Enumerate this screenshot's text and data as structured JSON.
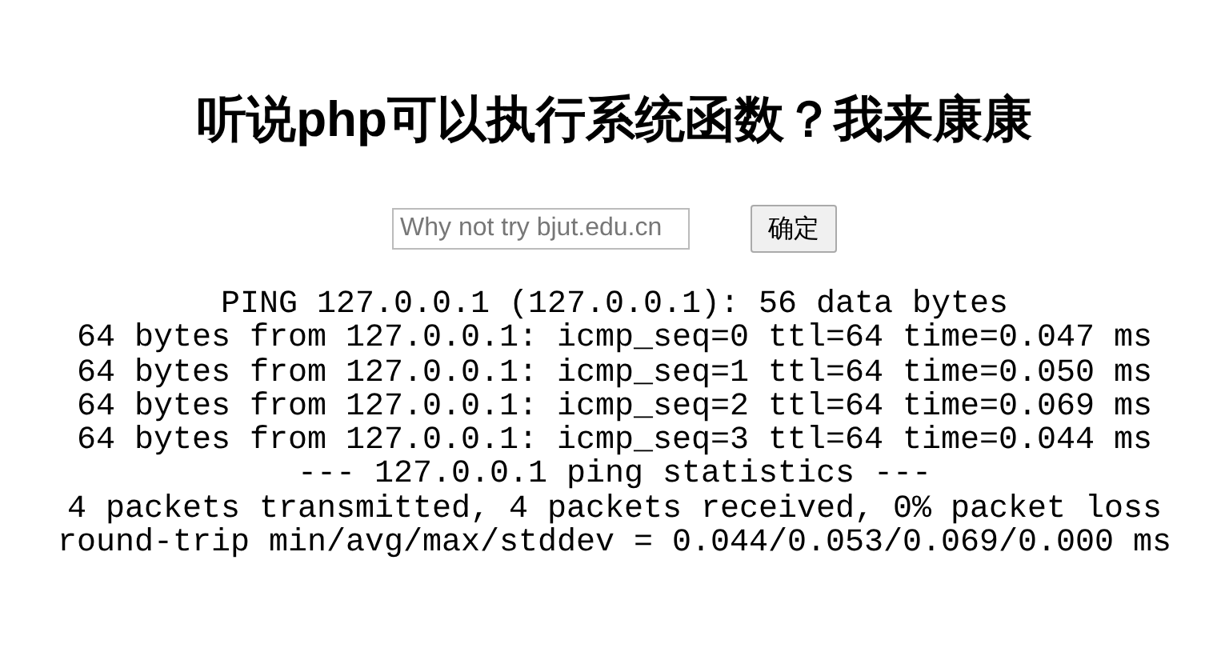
{
  "heading": "听说php可以执行系统函数？我来康康",
  "form": {
    "placeholder": "Why not try bjut.edu.cn",
    "submit": "确定"
  },
  "output_lines": [
    "PING 127.0.0.1 (127.0.0.1): 56 data bytes",
    "64 bytes from 127.0.0.1: icmp_seq=0 ttl=64 time=0.047 ms",
    "64 bytes from 127.0.0.1: icmp_seq=1 ttl=64 time=0.050 ms",
    "64 bytes from 127.0.0.1: icmp_seq=2 ttl=64 time=0.069 ms",
    "64 bytes from 127.0.0.1: icmp_seq=3 ttl=64 time=0.044 ms",
    "--- 127.0.0.1 ping statistics ---",
    "4 packets transmitted, 4 packets received, 0% packet loss",
    "round-trip min/avg/max/stddev = 0.044/0.053/0.069/0.000 ms"
  ]
}
